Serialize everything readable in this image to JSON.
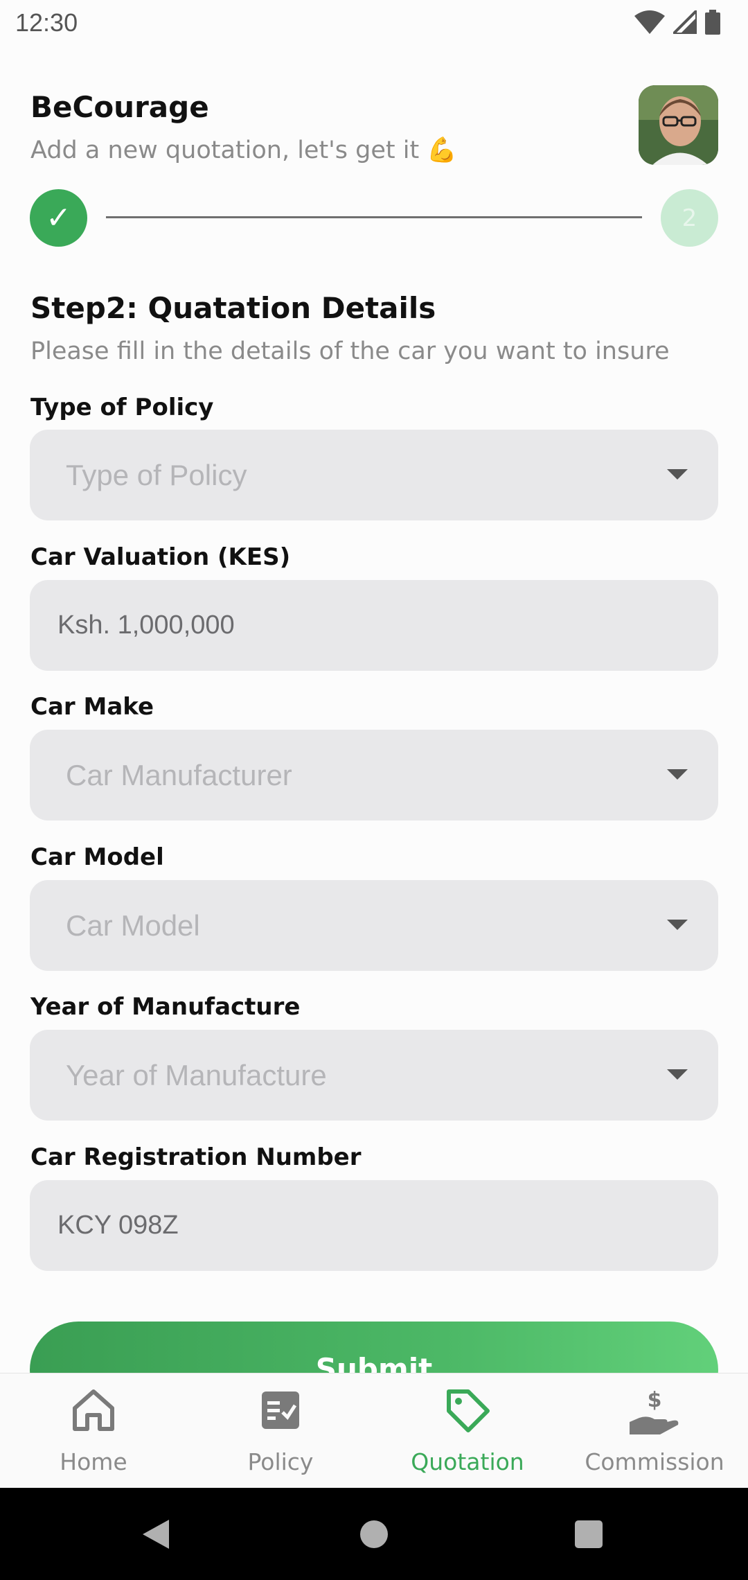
{
  "status_bar": {
    "time": "12:30"
  },
  "header": {
    "title": "BeCourage",
    "subtitle": "Add a new quotation, let's get it 💪"
  },
  "stepper": {
    "done_symbol": "✓",
    "pending_step": "2"
  },
  "section": {
    "title": "Step2: Quatation Details",
    "subtitle": "Please fill in the details of the car you want to insure"
  },
  "form": {
    "policy_type": {
      "label": "Type of Policy",
      "placeholder": "Type of Policy"
    },
    "valuation": {
      "label": "Car Valuation (KES)",
      "value": "Ksh. 1,000,000"
    },
    "make": {
      "label": "Car Make",
      "placeholder": "Car Manufacturer"
    },
    "model": {
      "label": "Car Model",
      "placeholder": "Car Model"
    },
    "year": {
      "label": "Year of Manufacture",
      "placeholder": "Year of Manufacture"
    },
    "registration": {
      "label": "Car Registration Number",
      "value": "KCY 098Z"
    },
    "submit_label": "Submit"
  },
  "bottom_nav": {
    "items": [
      {
        "label": "Home",
        "icon": "home-icon"
      },
      {
        "label": "Policy",
        "icon": "policy-icon"
      },
      {
        "label": "Quotation",
        "icon": "tag-icon"
      },
      {
        "label": "Commission",
        "icon": "hand-dollar-icon"
      }
    ],
    "active_index": 2
  },
  "colors": {
    "accent": "#3aa958",
    "field_bg": "#e8e8ea",
    "pending_step": "#c9ebd3"
  }
}
